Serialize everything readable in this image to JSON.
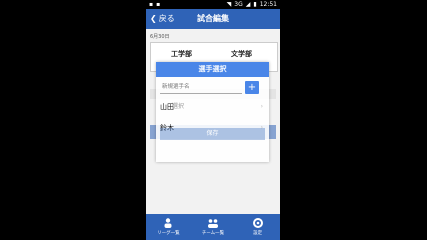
{
  "status": {
    "network": "3G",
    "time": "12:51"
  },
  "appbar": {
    "back_label": "戻る",
    "title": "試合編集"
  },
  "content": {
    "date": "6月30日",
    "team_left": "工学部",
    "team_right": "文学部"
  },
  "dialog": {
    "title": "選手選択",
    "input_placeholder": "新規選手名",
    "add_label": "+",
    "players": [
      "山田",
      "鈴木"
    ],
    "ghost_select": "選択",
    "confirm_label": "保存"
  },
  "bottomnav": {
    "items": [
      "リーグ一覧",
      "チーム一覧",
      "設定"
    ]
  },
  "colors": {
    "primary": "#2f63b7",
    "dialog_header": "#4a86e8"
  }
}
